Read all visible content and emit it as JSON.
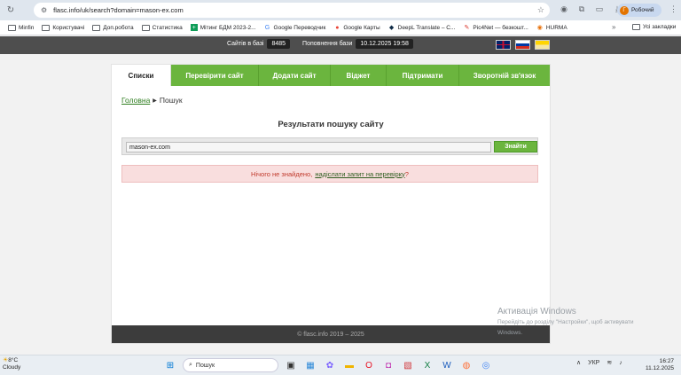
{
  "browser": {
    "url": "flasc.info/uk/search?domain=mason-ex.com",
    "profile_initial": "Г",
    "profile_name": "Робочий",
    "bookmarks": [
      {
        "label": "Minfin",
        "icon": "folder-icon"
      },
      {
        "label": "Користувачі",
        "icon": "folder-icon"
      },
      {
        "label": "Доп.робота",
        "icon": "folder-icon"
      },
      {
        "label": "Статистика",
        "icon": "folder-icon"
      },
      {
        "label": "Мітинг БДМ 2023-2...",
        "icon": "sheets-icon"
      },
      {
        "label": "Google Переводчик",
        "icon": "translate-icon"
      },
      {
        "label": "Google Карты",
        "icon": "maps-icon"
      },
      {
        "label": "DeepL Translate – С...",
        "icon": "deepl-icon"
      },
      {
        "label": "Pic4Net — безкошт...",
        "icon": "pic4net-icon"
      },
      {
        "label": "HURMA",
        "icon": "hurma-icon"
      }
    ],
    "more_label": "»",
    "all_bookmarks_label": "Усі закладки"
  },
  "site": {
    "stats_sites_label": "Сайтів в базі",
    "stats_sites_value": "8485",
    "stats_updated_label": "Поповнення бази",
    "stats_updated_value": "10.12.2025 19:58",
    "tabs": [
      {
        "label": "Списки",
        "active": true
      },
      {
        "label": "Перевірити сайт",
        "active": false
      },
      {
        "label": "Додати сайт",
        "active": false
      },
      {
        "label": "Віджет",
        "active": false
      },
      {
        "label": "Підтримати",
        "active": false
      },
      {
        "label": "Зворотній зв'язок",
        "active": false
      }
    ],
    "breadcrumb_home": "Головна",
    "breadcrumb_current": "Пошук",
    "heading": "Результати пошуку сайту",
    "search_value": "mason-ex.com",
    "search_button": "Знайти",
    "alert_text": "Нічого не знайдено,",
    "alert_link": "надіслати запит на перевірку",
    "alert_suffix": "?",
    "footer": "© flasc.info 2019 – 2025",
    "accent_color": "#6bb53e"
  },
  "watermark": {
    "line1": "Активація Windows",
    "line2": "Перейдіть до розділу \"Настройки\", щоб активувати",
    "line3": "Windows."
  },
  "taskbar": {
    "temperature": "8°C",
    "weather": "Cloudy",
    "search_label": "Пошук",
    "language": "УКР",
    "time": "16:27",
    "date": "11.12.2025"
  }
}
